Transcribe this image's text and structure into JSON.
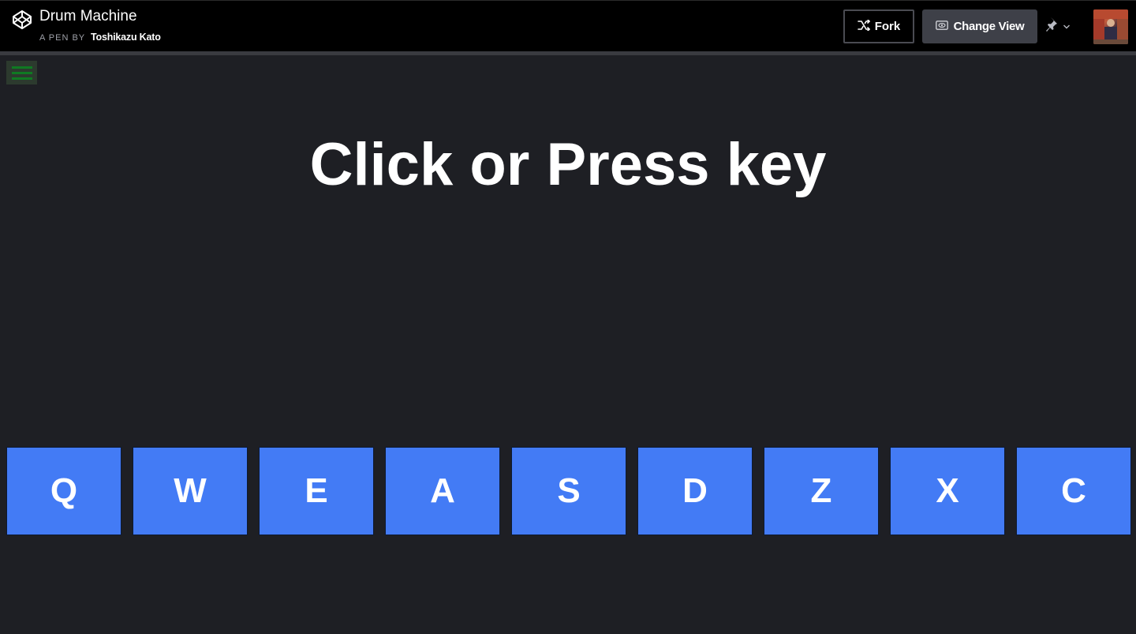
{
  "header": {
    "pen_title": "Drum Machine",
    "pen_by_label": "A PEN BY",
    "author": "Toshikazu Kato",
    "fork_label": "Fork",
    "change_view_label": "Change View",
    "icons": {
      "logo": "codepen-logo-icon",
      "fork": "fork-icon",
      "change_view": "eye-icon",
      "pin": "pin-icon",
      "chevron": "chevron-down-icon"
    }
  },
  "main": {
    "title": "Click or Press key",
    "menu_color": "#0f7a22"
  },
  "pads": [
    {
      "key": "Q"
    },
    {
      "key": "W"
    },
    {
      "key": "E"
    },
    {
      "key": "A"
    },
    {
      "key": "S"
    },
    {
      "key": "D"
    },
    {
      "key": "Z"
    },
    {
      "key": "X"
    },
    {
      "key": "C"
    }
  ],
  "colors": {
    "pad": "#437bf5",
    "background": "#1e1f24",
    "header": "#000000"
  }
}
